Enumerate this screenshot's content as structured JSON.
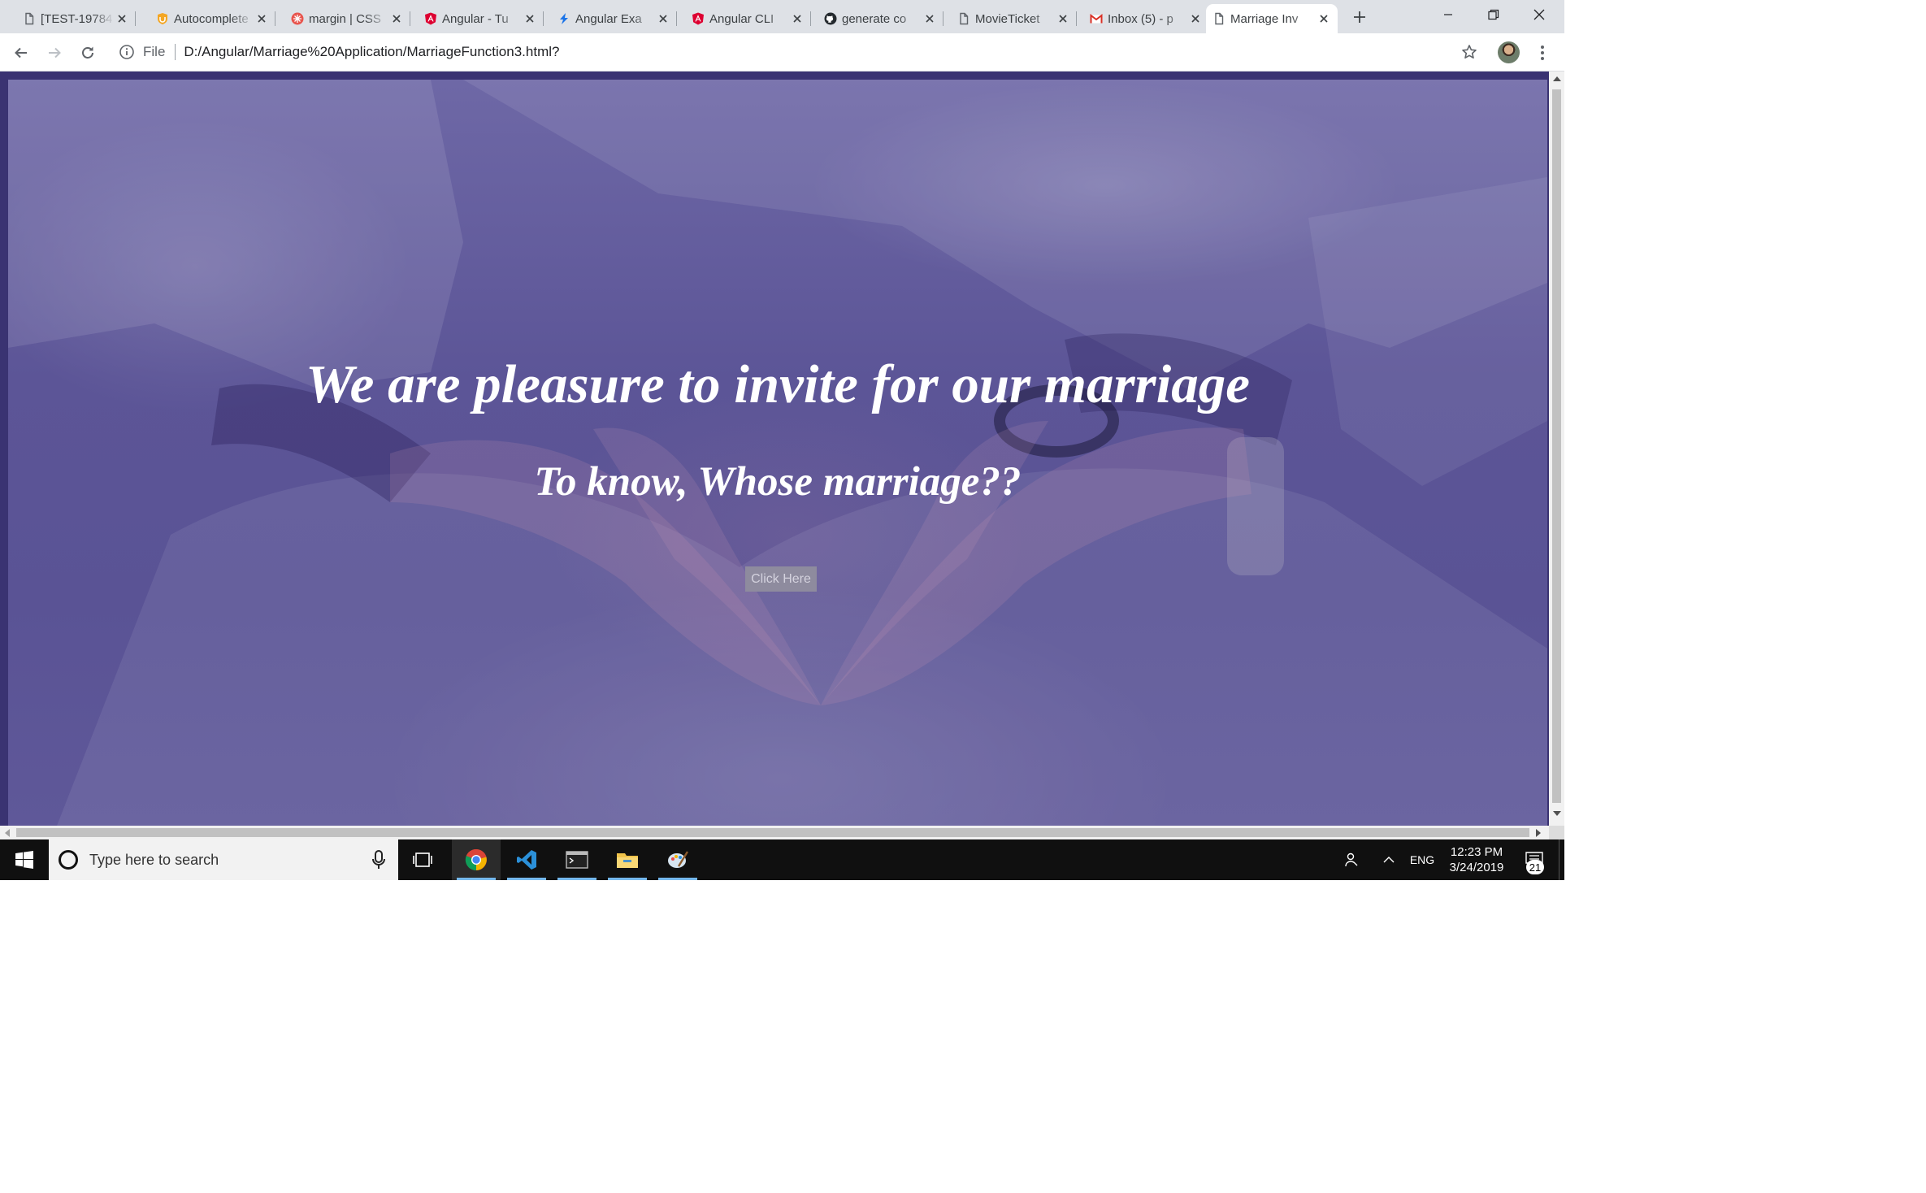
{
  "browser": {
    "tabs": [
      {
        "title": "[TEST-19784",
        "favicon": "page-icon"
      },
      {
        "title": "Autocomplete",
        "favicon": "shield-icon"
      },
      {
        "title": "margin | CSS",
        "favicon": "css-tricks-icon"
      },
      {
        "title": "Angular - Tu",
        "favicon": "angular-icon"
      },
      {
        "title": "Angular Exa",
        "favicon": "lightning-icon"
      },
      {
        "title": "Angular CLI",
        "favicon": "angular-icon"
      },
      {
        "title": "generate co",
        "favicon": "github-icon"
      },
      {
        "title": "MovieTicket",
        "favicon": "page-icon"
      },
      {
        "title": "Inbox (5) - p",
        "favicon": "gmail-icon"
      },
      {
        "title": "Marriage Inv",
        "favicon": "page-icon",
        "active": true
      }
    ],
    "address_bar": {
      "scheme_label": "File",
      "url": "D:/Angular/Marriage%20Application/MarriageFunction3.html?"
    }
  },
  "page": {
    "heading": "We are pleasure to invite for our marriage",
    "subheading": "To know, Whose marriage??",
    "button_label": "Click Here",
    "overlay_color": "#5a5395"
  },
  "taskbar": {
    "search_placeholder": "Type here to search",
    "apps": [
      "task-view-icon",
      "chrome-icon",
      "vscode-icon",
      "terminal-icon",
      "file-explorer-icon",
      "paint-icon"
    ],
    "language": "ENG",
    "time": "12:23 PM",
    "date": "3/24/2019",
    "notification_count": "21"
  },
  "colors": {
    "tab_strip": "#dee1e6",
    "taskbar": "#101010",
    "taskbar_accent": "#76b9ed"
  }
}
